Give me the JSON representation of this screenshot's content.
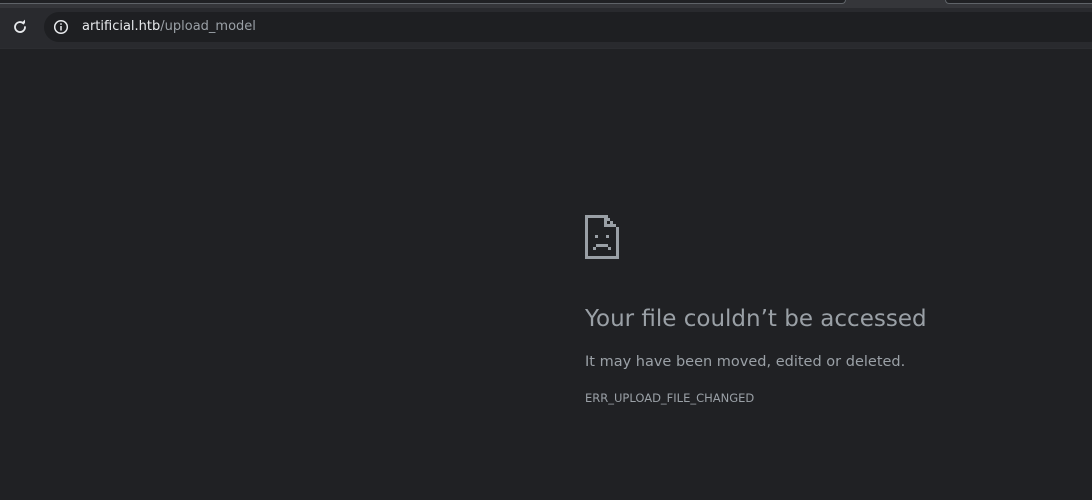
{
  "browser": {
    "reload_icon": "reload-icon",
    "site_info_icon": "info-circle-icon",
    "url_host": "artificial.htb",
    "url_path": "/upload_model"
  },
  "error_page": {
    "icon": "sad-file-icon",
    "heading": "Your file couldn’t be accessed",
    "message": "It may have been moved, edited or deleted.",
    "error_code": "ERR_UPLOAD_FILE_CHANGED"
  },
  "colors": {
    "page_background": "#202124",
    "toolbar_background": "#292a2e",
    "text_secondary": "#9aa0a6",
    "text_primary": "#e8eaed"
  }
}
